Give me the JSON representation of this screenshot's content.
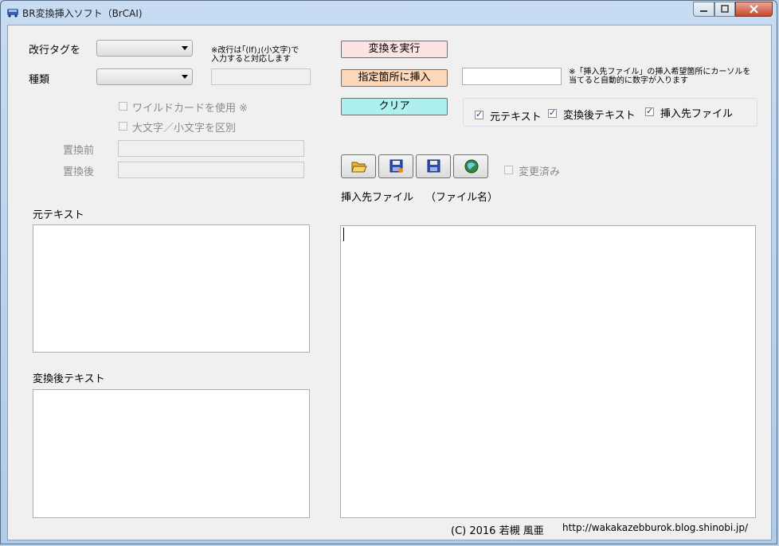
{
  "window": {
    "title": "BR変換挿入ソフト（BrCAI)"
  },
  "form": {
    "newline_tag_label": "改行タグを",
    "type_label": "種類",
    "newline_note": "※改行は｢(lf)｣(小文字)で\n入力すると対応します",
    "wildcard_label": "ワイルドカードを使用 ※",
    "case_label": "大文字／小文字を区別",
    "before_label": "置換前",
    "after_label": "置換後"
  },
  "buttons": {
    "execute": "変換を実行",
    "insert": "指定箇所に挿入",
    "clear": "クリア"
  },
  "insert_note": "※「挿入先ファイル」の挿入希望箇所にカーソルを\n当てると自動的に数字が入ります",
  "view_checks": [
    {
      "label": "元テキスト",
      "checked": true
    },
    {
      "label": "変換後テキスト",
      "checked": true
    },
    {
      "label": "挿入先ファイル",
      "checked": true
    }
  ],
  "toolbar": {
    "icons": [
      "open-folder-icon",
      "save-as-icon",
      "save-icon",
      "browser-icon"
    ],
    "modified_label": "変更済み"
  },
  "file": {
    "label": "挿入先ファイル",
    "name": "（ファイル名）"
  },
  "panels": {
    "source_label": "元テキスト",
    "converted_label": "変換後テキスト"
  },
  "footer": {
    "copyright": "(C) 2016 若槻 風亜",
    "url": "http://wakakazebburok.blog.shinobi.jp/"
  }
}
